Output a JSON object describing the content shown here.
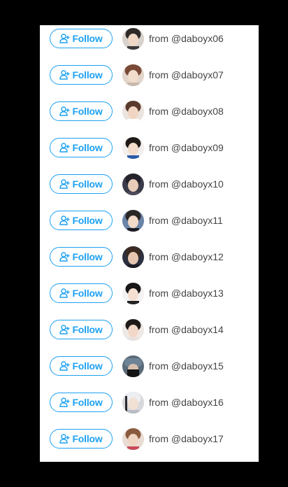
{
  "colors": {
    "accent": "#1da1f2",
    "text": "#444444",
    "background": "#ffffff",
    "frame": "#000000"
  },
  "follow_icon": "add-user-icon",
  "rows": [
    {
      "follow_label": "Follow",
      "from_text": "from @daboyx06",
      "avatar_icon": "avatar-photo"
    },
    {
      "follow_label": "Follow",
      "from_text": "from @daboyx07",
      "avatar_icon": "avatar-photo"
    },
    {
      "follow_label": "Follow",
      "from_text": "from @daboyx08",
      "avatar_icon": "avatar-photo"
    },
    {
      "follow_label": "Follow",
      "from_text": "from @daboyx09",
      "avatar_icon": "avatar-photo"
    },
    {
      "follow_label": "Follow",
      "from_text": "from @daboyx10",
      "avatar_icon": "avatar-photo"
    },
    {
      "follow_label": "Follow",
      "from_text": "from @daboyx11",
      "avatar_icon": "avatar-photo"
    },
    {
      "follow_label": "Follow",
      "from_text": "from @daboyx12",
      "avatar_icon": "avatar-photo"
    },
    {
      "follow_label": "Follow",
      "from_text": "from @daboyx13",
      "avatar_icon": "avatar-photo"
    },
    {
      "follow_label": "Follow",
      "from_text": "from @daboyx14",
      "avatar_icon": "avatar-photo"
    },
    {
      "follow_label": "Follow",
      "from_text": "from @daboyx15",
      "avatar_icon": "avatar-photo"
    },
    {
      "follow_label": "Follow",
      "from_text": "from @daboyx16",
      "avatar_icon": "avatar-photo"
    },
    {
      "follow_label": "Follow",
      "from_text": "from @daboyx17",
      "avatar_icon": "avatar-photo"
    }
  ]
}
